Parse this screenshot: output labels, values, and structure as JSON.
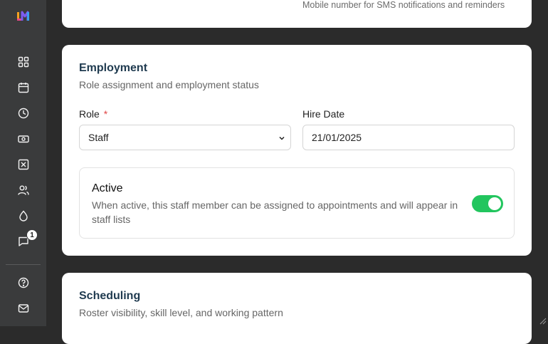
{
  "sidebar": {
    "logo_text": "LM",
    "icons": [
      "dashboard-icon",
      "calendar-icon",
      "clock-icon",
      "cash-icon",
      "x-box-icon",
      "users-icon",
      "droplet-icon",
      "message-icon",
      "help-icon",
      "mail-icon"
    ],
    "messages_badge": "1"
  },
  "contact_card": {
    "hint": "Mobile number for SMS notifications and reminders"
  },
  "employment": {
    "title": "Employment",
    "subtitle": "Role assignment and employment status",
    "role_label": "Role",
    "role_required_mark": "*",
    "role_value": "Staff",
    "hire_date_label": "Hire Date",
    "hire_date_value": "21/01/2025",
    "active": {
      "title": "Active",
      "description": "When active, this staff member can be assigned to appointments and will appear in staff lists",
      "enabled": true
    }
  },
  "scheduling": {
    "title": "Scheduling",
    "subtitle": "Roster visibility, skill level, and working pattern"
  },
  "colors": {
    "sidebar_bg": "#3a3b3c",
    "page_bg": "#2b2b2b",
    "title": "#1f3a4f",
    "toggle_on": "#22c55e",
    "required": "#e04545"
  }
}
